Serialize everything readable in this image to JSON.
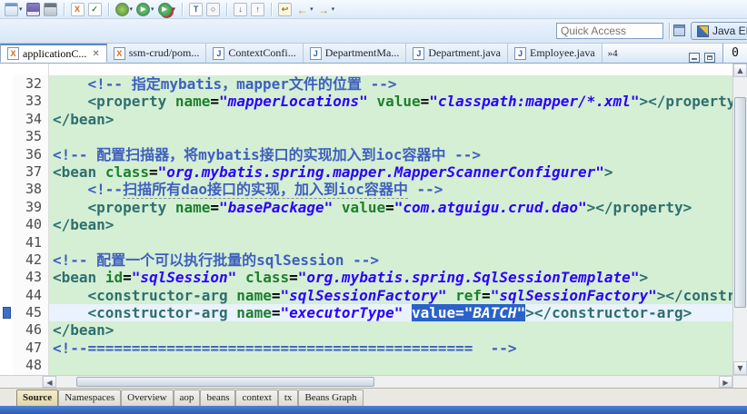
{
  "colors": {
    "editor_bg": "#d4efd4",
    "current_line_bg": "#e9f2fd",
    "selection_bg": "#2a62c9",
    "tag": "#2f6f6f",
    "attr": "#1e7f2f",
    "value": "#2a00ff",
    "comment": "#3f5fbf"
  },
  "toolbar": {
    "items": [
      {
        "name": "new-wizard-icon",
        "caret": true
      },
      {
        "name": "save-icon"
      },
      {
        "name": "print-icon"
      },
      {
        "sep": true
      },
      {
        "name": "new-xml-file-icon"
      },
      {
        "name": "validate-icon"
      },
      {
        "sep": true
      },
      {
        "name": "debug-icon",
        "caret": true
      },
      {
        "name": "run-icon",
        "caret": true
      },
      {
        "name": "external-tools-icon",
        "caret": true
      },
      {
        "sep": true
      },
      {
        "name": "open-type-icon"
      },
      {
        "name": "search-icon"
      },
      {
        "sep": true
      },
      {
        "name": "next-annotation-icon"
      },
      {
        "name": "prev-annotation-icon"
      },
      {
        "sep": true
      },
      {
        "name": "last-edit-location-icon"
      },
      {
        "name": "back-icon",
        "caret": true
      },
      {
        "name": "forward-icon",
        "caret": true
      }
    ]
  },
  "quick_access": {
    "placeholder": "Quick Access"
  },
  "perspectives": {
    "active_label": "Java EE"
  },
  "editor_tabs": {
    "close_glyph": "✕",
    "overflow_label": "»4",
    "right_pane_label": "0",
    "tabs": [
      {
        "label": "applicationC...",
        "icon": "xml-file-icon",
        "active": true
      },
      {
        "label": "ssm-crud/pom...",
        "icon": "xml-file-icon",
        "active": false
      },
      {
        "label": "ContextConfi...",
        "icon": "java-file-icon",
        "active": false
      },
      {
        "label": "DepartmentMa...",
        "icon": "java-file-icon",
        "active": false
      },
      {
        "label": "Department.java",
        "icon": "java-file-icon",
        "active": false
      },
      {
        "label": "Employee.java",
        "icon": "java-file-icon",
        "active": false
      }
    ]
  },
  "editor": {
    "lines": [
      {
        "n": 32,
        "seg": [
          [
            "p",
            "    "
          ],
          [
            "c",
            "<!-- "
          ],
          [
            "cu",
            "指定mybatis，mapper文件的位置"
          ],
          [
            "c",
            " -->"
          ]
        ]
      },
      {
        "n": 33,
        "seg": [
          [
            "p",
            "    "
          ],
          [
            "g",
            "<property"
          ],
          [
            "p",
            " "
          ],
          [
            "a",
            "name"
          ],
          [
            "p",
            "="
          ],
          [
            "v",
            "\"mapperLocations\""
          ],
          [
            "p",
            " "
          ],
          [
            "a",
            "value"
          ],
          [
            "p",
            "="
          ],
          [
            "v",
            "\"classpath:mapper/*.xml\""
          ],
          [
            "g",
            "></property>"
          ]
        ]
      },
      {
        "n": 34,
        "seg": [
          [
            "g",
            "</bean>"
          ]
        ]
      },
      {
        "n": 35,
        "seg": []
      },
      {
        "n": 36,
        "seg": [
          [
            "c",
            "<!-- "
          ],
          [
            "cu",
            "配置扫描器，将mybatis接口的实现加入到ioc容器中"
          ],
          [
            "c",
            " -->"
          ]
        ]
      },
      {
        "n": 37,
        "seg": [
          [
            "g",
            "<bean"
          ],
          [
            "p",
            " "
          ],
          [
            "a",
            "class"
          ],
          [
            "p",
            "="
          ],
          [
            "v",
            "\"org.mybatis.spring.mapper.MapperScannerConfigurer\""
          ],
          [
            "g",
            ">"
          ]
        ]
      },
      {
        "n": 38,
        "seg": [
          [
            "p",
            "    "
          ],
          [
            "c",
            "<!--"
          ],
          [
            "cu",
            "扫描所有dao接口的实现，加入到ioc容器中"
          ],
          [
            "c",
            " -->"
          ]
        ]
      },
      {
        "n": 39,
        "seg": [
          [
            "p",
            "    "
          ],
          [
            "g",
            "<property"
          ],
          [
            "p",
            " "
          ],
          [
            "a",
            "name"
          ],
          [
            "p",
            "="
          ],
          [
            "v",
            "\"basePackage\""
          ],
          [
            "p",
            " "
          ],
          [
            "a",
            "value"
          ],
          [
            "p",
            "="
          ],
          [
            "v",
            "\"com.atguigu.crud.dao\""
          ],
          [
            "g",
            "></property>"
          ]
        ]
      },
      {
        "n": 40,
        "seg": [
          [
            "g",
            "</bean>"
          ]
        ]
      },
      {
        "n": 41,
        "seg": []
      },
      {
        "n": 42,
        "seg": [
          [
            "c",
            "<!-- "
          ],
          [
            "cu",
            "配置一个可以执行批量的sqlSession"
          ],
          [
            "c",
            " -->"
          ]
        ]
      },
      {
        "n": 43,
        "seg": [
          [
            "g",
            "<bean"
          ],
          [
            "p",
            " "
          ],
          [
            "a",
            "id"
          ],
          [
            "p",
            "="
          ],
          [
            "v",
            "\"sqlSession\""
          ],
          [
            "p",
            " "
          ],
          [
            "a",
            "class"
          ],
          [
            "p",
            "="
          ],
          [
            "v",
            "\"org.mybatis.spring.SqlSessionTemplate\""
          ],
          [
            "g",
            ">"
          ]
        ]
      },
      {
        "n": 44,
        "seg": [
          [
            "p",
            "    "
          ],
          [
            "g",
            "<constructor-arg"
          ],
          [
            "p",
            " "
          ],
          [
            "a",
            "name"
          ],
          [
            "p",
            "="
          ],
          [
            "v",
            "\"sqlSessionFactory\""
          ],
          [
            "p",
            " "
          ],
          [
            "a",
            "ref"
          ],
          [
            "p",
            "="
          ],
          [
            "v",
            "\"sqlSessionFactory\""
          ],
          [
            "g",
            "></constructor-arg>"
          ]
        ]
      },
      {
        "n": 45,
        "cur": true,
        "marker": true,
        "seg": [
          [
            "p",
            "    "
          ],
          [
            "g",
            "<constructor-arg"
          ],
          [
            "p",
            " "
          ],
          [
            "a",
            "name"
          ],
          [
            "p",
            "="
          ],
          [
            "v",
            "\"executorType\""
          ],
          [
            "p",
            " "
          ],
          [
            "sel",
            "value="
          ],
          [
            "seli",
            "\"BATCH\""
          ],
          [
            "g",
            "></constructor-arg>"
          ]
        ]
      },
      {
        "n": 46,
        "seg": [
          [
            "g",
            "</bean>"
          ]
        ]
      },
      {
        "n": 47,
        "seg": [
          [
            "c",
            "<!--============================================  -->"
          ]
        ]
      },
      {
        "n": 48,
        "seg": []
      }
    ]
  },
  "bottom_tabs": {
    "tabs": [
      {
        "label": "Source",
        "active": true
      },
      {
        "label": "Namespaces",
        "active": false
      },
      {
        "label": "Overview",
        "active": false
      },
      {
        "label": "aop",
        "active": false
      },
      {
        "label": "beans",
        "active": false
      },
      {
        "label": "context",
        "active": false
      },
      {
        "label": "tx",
        "active": false
      },
      {
        "label": "Beans Graph",
        "active": false
      }
    ]
  }
}
